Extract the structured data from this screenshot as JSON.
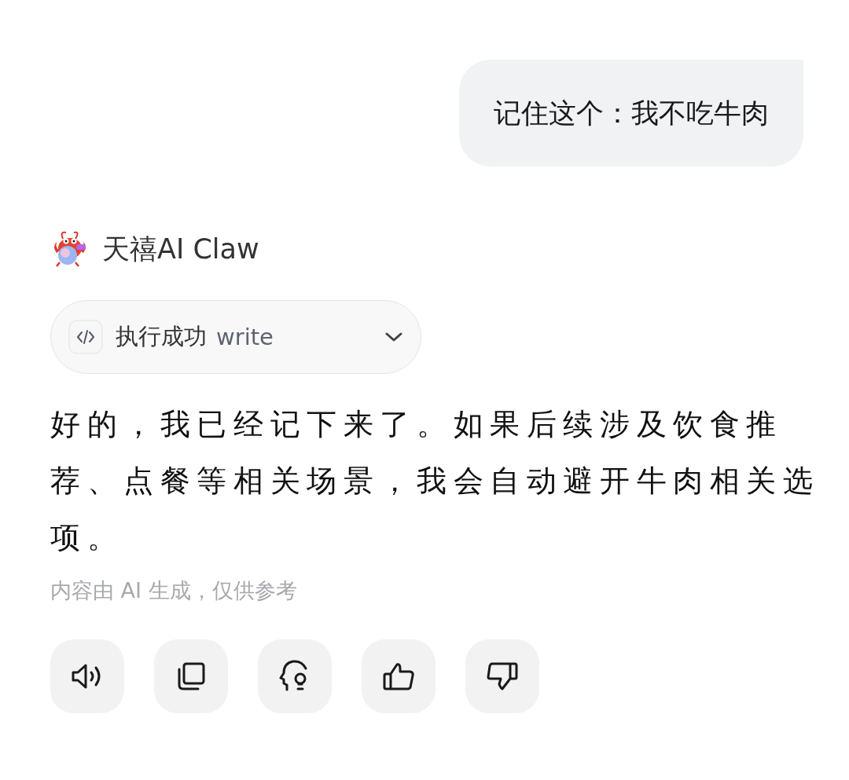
{
  "user_message": {
    "text": "记住这个：我不吃牛肉"
  },
  "assistant": {
    "name": "天禧AI Claw"
  },
  "tool_call": {
    "status": "执行成功",
    "tool": "write",
    "expanded": false
  },
  "reply": {
    "text": "好的，我已经记下来了。如果后续涉及饮食推荐、点餐等相关场景，我会自动避开牛肉相关选项。"
  },
  "disclaimer": "内容由 AI 生成，仅供参考",
  "actions": [
    {
      "kind": "speaker"
    },
    {
      "kind": "copy"
    },
    {
      "kind": "idea"
    },
    {
      "kind": "like"
    },
    {
      "kind": "dislike"
    }
  ]
}
